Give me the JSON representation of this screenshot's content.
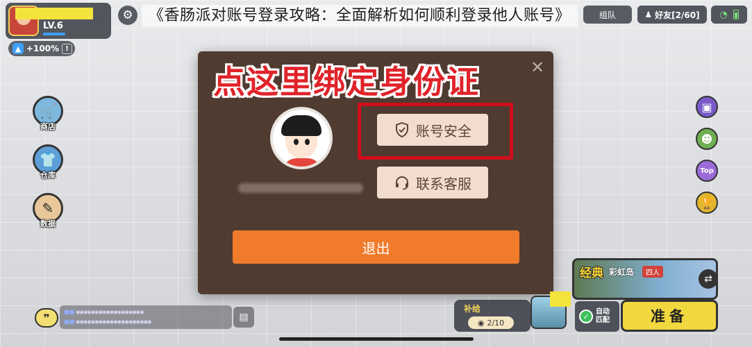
{
  "article_title": "《香肠派对账号登录攻略：全面解析如何顺利登录他人账号》",
  "profile": {
    "level": "LV.6",
    "xp_fraction": 0.35
  },
  "bonus": {
    "text": "+100%",
    "info_glyph": "!"
  },
  "top_right": {
    "team_label": "组队",
    "friends_label": "好友[2/60]"
  },
  "left_nav": [
    {
      "label": "商店",
      "icon": "shop-icon"
    },
    {
      "label": "仓库",
      "icon": "wardrobe-icon"
    },
    {
      "label": "数据",
      "icon": "stats-icon"
    }
  ],
  "right_nav": [
    {
      "icon": "tv-icon"
    },
    {
      "icon": "character-icon"
    },
    {
      "icon": "top-icon",
      "text": "Top"
    },
    {
      "icon": "trophy-icon"
    }
  ],
  "modal": {
    "headline": "点这里绑定身份证",
    "close_glyph": "✕",
    "account_security_label": "账号安全",
    "customer_service_label": "联系客服",
    "exit_label": "退出"
  },
  "chat": {
    "toggle_glyph": "❞"
  },
  "supply": {
    "label": "补给",
    "count": "2/10"
  },
  "mode": {
    "classic": "经典",
    "map": "彩虹岛",
    "players": "四人",
    "auto_match": "自动\n匹配",
    "ready": "准备"
  },
  "colors": {
    "modal_bg": "#4f3b30",
    "headline_red": "#e0232a",
    "highlight_red": "#d10e1c",
    "exit_orange": "#f07b2b",
    "ready_yellow": "#f2d83f"
  }
}
